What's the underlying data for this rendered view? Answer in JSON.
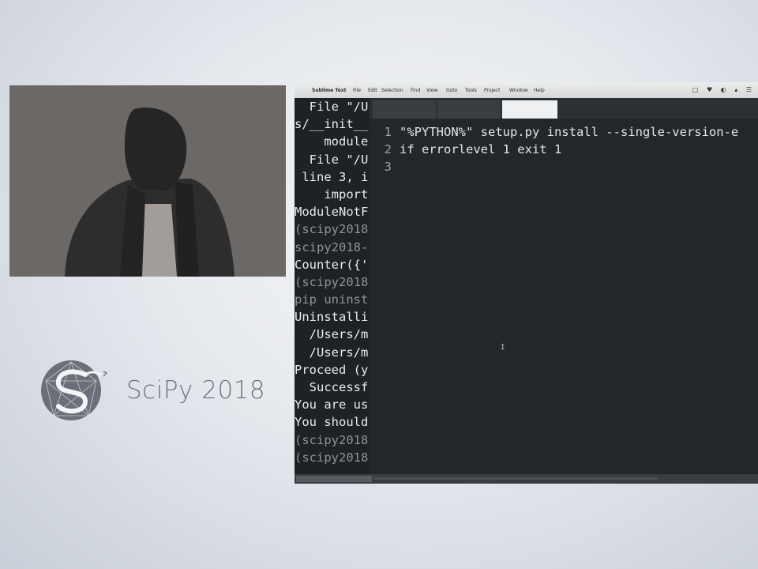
{
  "brand": {
    "logo_name": "scipy-snake-logo",
    "text": "SciPy 2018",
    "text_color": "#6f747c"
  },
  "menubar": {
    "app": "Sublime Text",
    "items": [
      "File",
      "Edit",
      "Selection",
      "Find",
      "View",
      "Goto",
      "Tools",
      "Project",
      "Window",
      "Help"
    ]
  },
  "terminal": {
    "lines": [
      {
        "text": "  File \"/U",
        "dim": false
      },
      {
        "text": "s/__init__",
        "dim": false
      },
      {
        "text": "    module",
        "dim": false
      },
      {
        "text": "  File \"/U",
        "dim": false
      },
      {
        "text": " line 3, i",
        "dim": false
      },
      {
        "text": "    import",
        "dim": false
      },
      {
        "text": "ModuleNotF",
        "dim": false
      },
      {
        "text": "(scipy2018",
        "dim": true
      },
      {
        "text": "scipy2018-",
        "dim": true
      },
      {
        "text": "Counter({'",
        "dim": false
      },
      {
        "text": "(scipy2018",
        "dim": true
      },
      {
        "text": "pip uninst",
        "dim": true
      },
      {
        "text": "Uninstalli",
        "dim": false
      },
      {
        "text": "  /Users/m",
        "dim": false
      },
      {
        "text": "  /Users/m",
        "dim": false
      },
      {
        "text": "Proceed (y",
        "dim": false
      },
      {
        "text": "  Successf",
        "dim": false
      },
      {
        "text": "You are us",
        "dim": false
      },
      {
        "text": "You should",
        "dim": false
      },
      {
        "text": "(scipy2018",
        "dim": true
      },
      {
        "text": "(scipy2018",
        "dim": true
      }
    ]
  },
  "editor": {
    "code": [
      {
        "n": "1",
        "text": "\"%PYTHON%\" setup.py install --single-version-e"
      },
      {
        "n": "2",
        "text": "if errorlevel 1 exit 1"
      },
      {
        "n": "3",
        "text": ""
      }
    ],
    "colors": {
      "background": "#23272a",
      "text": "#e3e6ea",
      "line_numbers": "#9aa1a8"
    }
  }
}
